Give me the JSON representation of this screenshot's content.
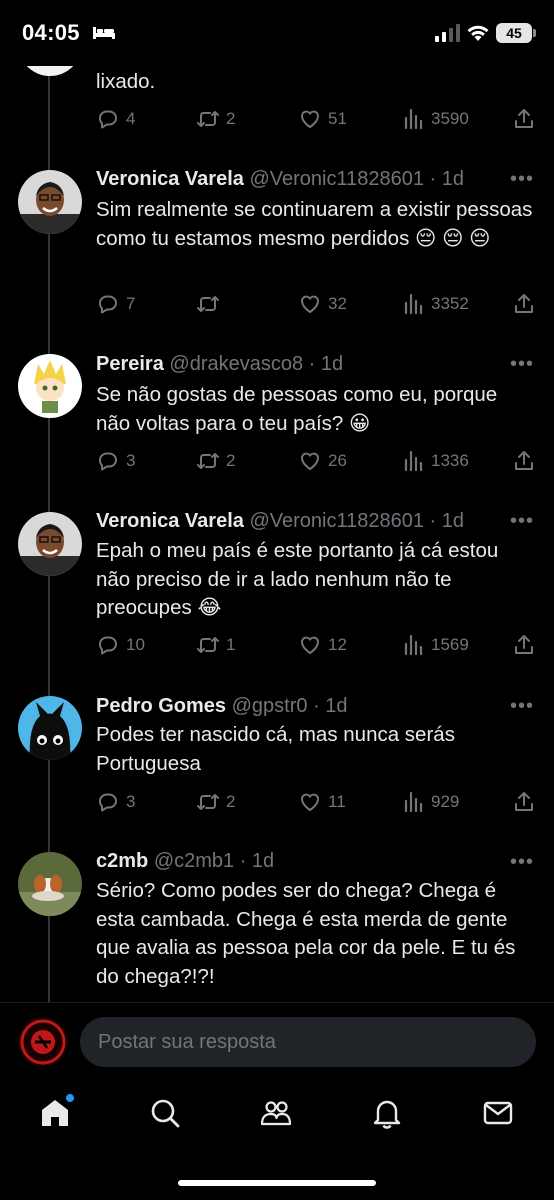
{
  "status_bar": {
    "time": "04:05",
    "battery": "45"
  },
  "tweets": [
    {
      "text": "lixado.",
      "replies": "4",
      "retweets": "2",
      "likes": "51",
      "views": "3590"
    },
    {
      "name": "Veronica Varela",
      "handle": "@Veronic11828601",
      "time": "· 1d",
      "text": "Sim realmente se continuarem a existir pessoas como tu estamos mesmo perdidos",
      "emoji": "😔 😔 😔",
      "replies": "7",
      "retweets": "",
      "likes": "32",
      "views": "3352"
    },
    {
      "name": "Pereira",
      "handle": "@drakevasco8",
      "time": "· 1d",
      "text": "Se não gostas de pessoas como eu, porque não voltas para o teu país?",
      "emoji": "😀",
      "replies": "3",
      "retweets": "2",
      "likes": "26",
      "views": "1336"
    },
    {
      "name": "Veronica Varela",
      "handle": "@Veronic11828601",
      "time": "· 1d",
      "text": "Epah o meu país é este portanto já cá estou não preciso de ir a lado nenhum não te preocupes",
      "emoji": "😂",
      "replies": "10",
      "retweets": "1",
      "likes": "12",
      "views": "1569"
    },
    {
      "name": "Pedro Gomes",
      "handle": "@gpstr0",
      "time": "· 1d",
      "text": "Podes ter nascido cá, mas nunca serás Portuguesa",
      "replies": "3",
      "retweets": "2",
      "likes": "11",
      "views": "929"
    },
    {
      "name": "c2mb",
      "handle": "@c2mb1",
      "time": "· 1d",
      "text": "Sério? Como podes ser do chega? Chega é esta cambada. Chega é esta merda de gente que avalia as pessoa pela cor da pele. E tu és do chega?!?!"
    }
  ],
  "reply_bar": {
    "placeholder": "Postar sua resposta"
  },
  "nav": [
    "home-icon",
    "search-icon",
    "communities-icon",
    "notifications-icon",
    "messages-icon"
  ],
  "colors": {
    "background": "#000000",
    "text": "#e7e9ea",
    "muted": "#71767b",
    "accent": "#1d9bf0"
  }
}
